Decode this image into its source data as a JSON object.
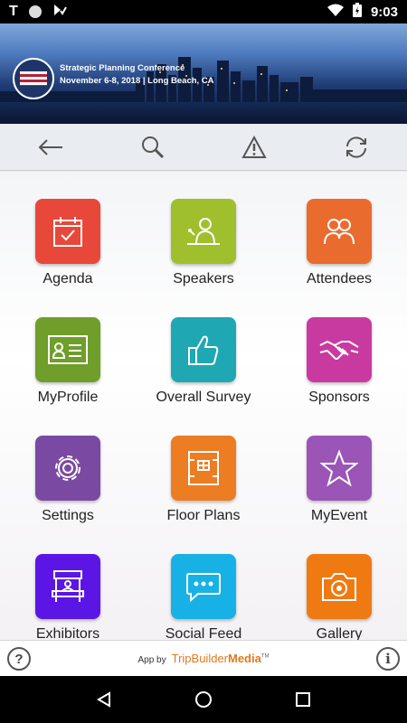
{
  "status_bar": {
    "time": "9:03",
    "left_icons": [
      "t-icon",
      "circle-icon",
      "signal-check-icon"
    ],
    "right_icons": [
      "wifi-icon",
      "battery-icon"
    ],
    "t_label": "T"
  },
  "banner": {
    "title": "Strategic Planning Conference",
    "subtitle": "November 6-8, 2018 | Long Beach, CA"
  },
  "toolbar": {
    "buttons": [
      "back-arrow-icon",
      "search-icon",
      "alert-icon",
      "refresh-icon"
    ]
  },
  "tiles": [
    {
      "label": "Agenda",
      "color": "#e8483a",
      "icon": "calendar-check-icon"
    },
    {
      "label": "Speakers",
      "color": "#9fbf2c",
      "icon": "speaker-podium-icon"
    },
    {
      "label": "Attendees",
      "color": "#ea6b2e",
      "icon": "people-icon"
    },
    {
      "label": "MyProfile",
      "color": "#6f9e2b",
      "icon": "id-card-icon"
    },
    {
      "label": "Overall Survey",
      "color": "#1fa8b3",
      "icon": "thumbs-up-icon"
    },
    {
      "label": "Sponsors",
      "color": "#c93aa0",
      "icon": "handshake-icon"
    },
    {
      "label": "Settings",
      "color": "#7a4aa3",
      "icon": "gear-icon"
    },
    {
      "label": "Floor Plans",
      "color": "#ec7d22",
      "icon": "floor-plan-icon"
    },
    {
      "label": "MyEvent",
      "color": "#9a55b6",
      "icon": "star-icon"
    },
    {
      "label": "Exhibitors",
      "color": "#5b16e6",
      "icon": "booth-icon"
    },
    {
      "label": "Social Feed",
      "color": "#18b1e6",
      "icon": "chat-bubble-icon"
    },
    {
      "label": "Gallery",
      "color": "#f07a12",
      "icon": "camera-icon"
    }
  ],
  "footer": {
    "app_by": "App by",
    "brand_a": "TripBuilder",
    "brand_b": "Media",
    "tm": "TM",
    "help": "?",
    "info": "i"
  },
  "nav_bar": {
    "buttons": [
      "back-triangle-icon",
      "home-circle-icon",
      "recents-square-icon"
    ]
  }
}
